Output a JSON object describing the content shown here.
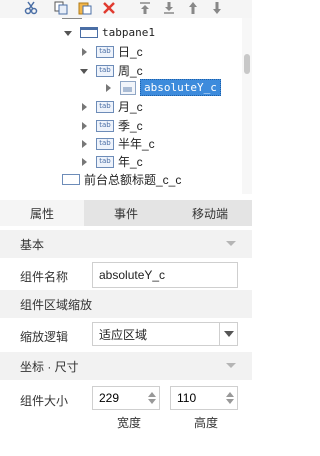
{
  "toolbar": {
    "icons": [
      "cut-icon",
      "copy-icon",
      "paste-icon",
      "delete-icon",
      "move-top-icon",
      "move-down-icon",
      "move-up-icon",
      "move-bottom-icon"
    ]
  },
  "tree": {
    "tabpane": "tabpane1",
    "items": [
      "日_c",
      "周_c",
      "absoluteY_c",
      "月_c",
      "季_c",
      "半年_c",
      "年_c"
    ],
    "tab_badge": "tab",
    "title_item": "前台总额标题_c_c"
  },
  "tabs": [
    "属性",
    "事件",
    "移动端"
  ],
  "props": {
    "section_basic": "基本",
    "name_label": "组件名称",
    "name_value": "absoluteY_c",
    "section_scale": "组件区域缩放",
    "scale_label": "缩放逻辑",
    "scale_value": "适应区域",
    "section_coords": "坐标 · 尺寸",
    "size_label": "组件大小",
    "width_value": "229",
    "height_value": "110",
    "width_label": "宽度",
    "height_label": "高度"
  },
  "colors": {
    "selection": "#3d8bdc",
    "delete_red": "#e03a2f",
    "section_bg": "#f2f2f2",
    "tab_bar": "#e4e4e4"
  }
}
